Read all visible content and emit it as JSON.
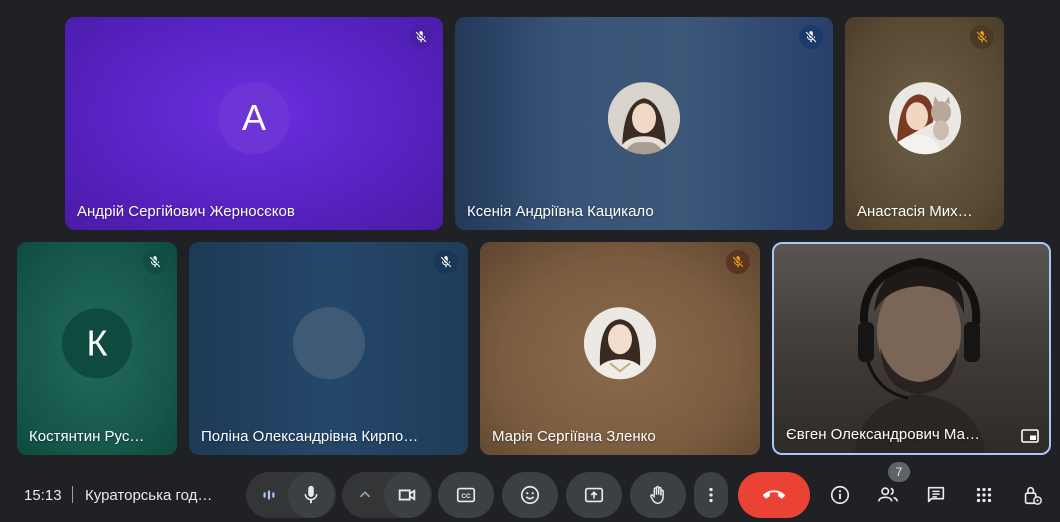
{
  "participants": [
    {
      "name": "Андрій Сергійович Жерносєков",
      "initial": "А",
      "muted": true
    },
    {
      "name": "Ксенія Андріївна Кацикало",
      "muted": true
    },
    {
      "name": "Анастасія Мих…",
      "muted": true
    },
    {
      "name": "Костянтин Рус…",
      "initial": "К",
      "muted": true
    },
    {
      "name": "Поліна Олександрівна Кирпо…",
      "muted": true
    },
    {
      "name": "Марія Сергіївна Зленко",
      "muted": true
    },
    {
      "name": "Євген Олександрович Ма…",
      "muted": false
    }
  ],
  "bar": {
    "time": "15:13",
    "meeting_title": "Кураторська год…",
    "participants_count": "7"
  },
  "colors": {
    "end_call": "#ea4335",
    "active_border": "#a8c7fa",
    "bar_button": "#3c4043"
  },
  "icons": [
    "mic-off-icon",
    "audio-level-icon",
    "mic-icon",
    "chevron-up-icon",
    "camera-icon",
    "captions-icon",
    "emoji-icon",
    "present-icon",
    "hand-icon",
    "more-vert-icon",
    "call-end-icon",
    "info-icon",
    "people-icon",
    "chat-icon",
    "apps-icon",
    "host-controls-icon",
    "pip-icon"
  ]
}
